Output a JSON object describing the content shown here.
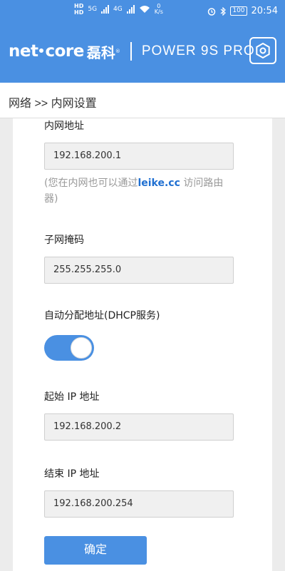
{
  "statusbar": {
    "hd_top": "HD",
    "hd_bottom": "HD",
    "net1": "5G",
    "net2": "4G",
    "speed_value": "0",
    "speed_unit": "K/s",
    "battery": "100",
    "time": "20:54"
  },
  "header": {
    "logo_text_left": "net",
    "logo_text_right": "core",
    "logo_cn": "磊科",
    "logo_reg": "®",
    "model": "POWER 9S PRO"
  },
  "breadcrumb": "网络 >> 内网设置",
  "form": {
    "lan_ip_label": "内网地址",
    "lan_ip_value": "192.168.200.1",
    "hint_before": "(您在内网也可以通过",
    "hint_link": "leike.cc",
    "hint_after": "访问路由器)",
    "subnet_label": "子网掩码",
    "subnet_value": "255.255.255.0",
    "dhcp_label": "自动分配地址(DHCP服务)",
    "dhcp_enabled": true,
    "start_ip_label": "起始 IP 地址",
    "start_ip_value": "192.168.200.2",
    "end_ip_label": "结束 IP 地址",
    "end_ip_value": "192.168.200.254",
    "confirm_label": "确定"
  },
  "colors": {
    "primary": "#4a90e2",
    "link": "#1f6fd1"
  }
}
